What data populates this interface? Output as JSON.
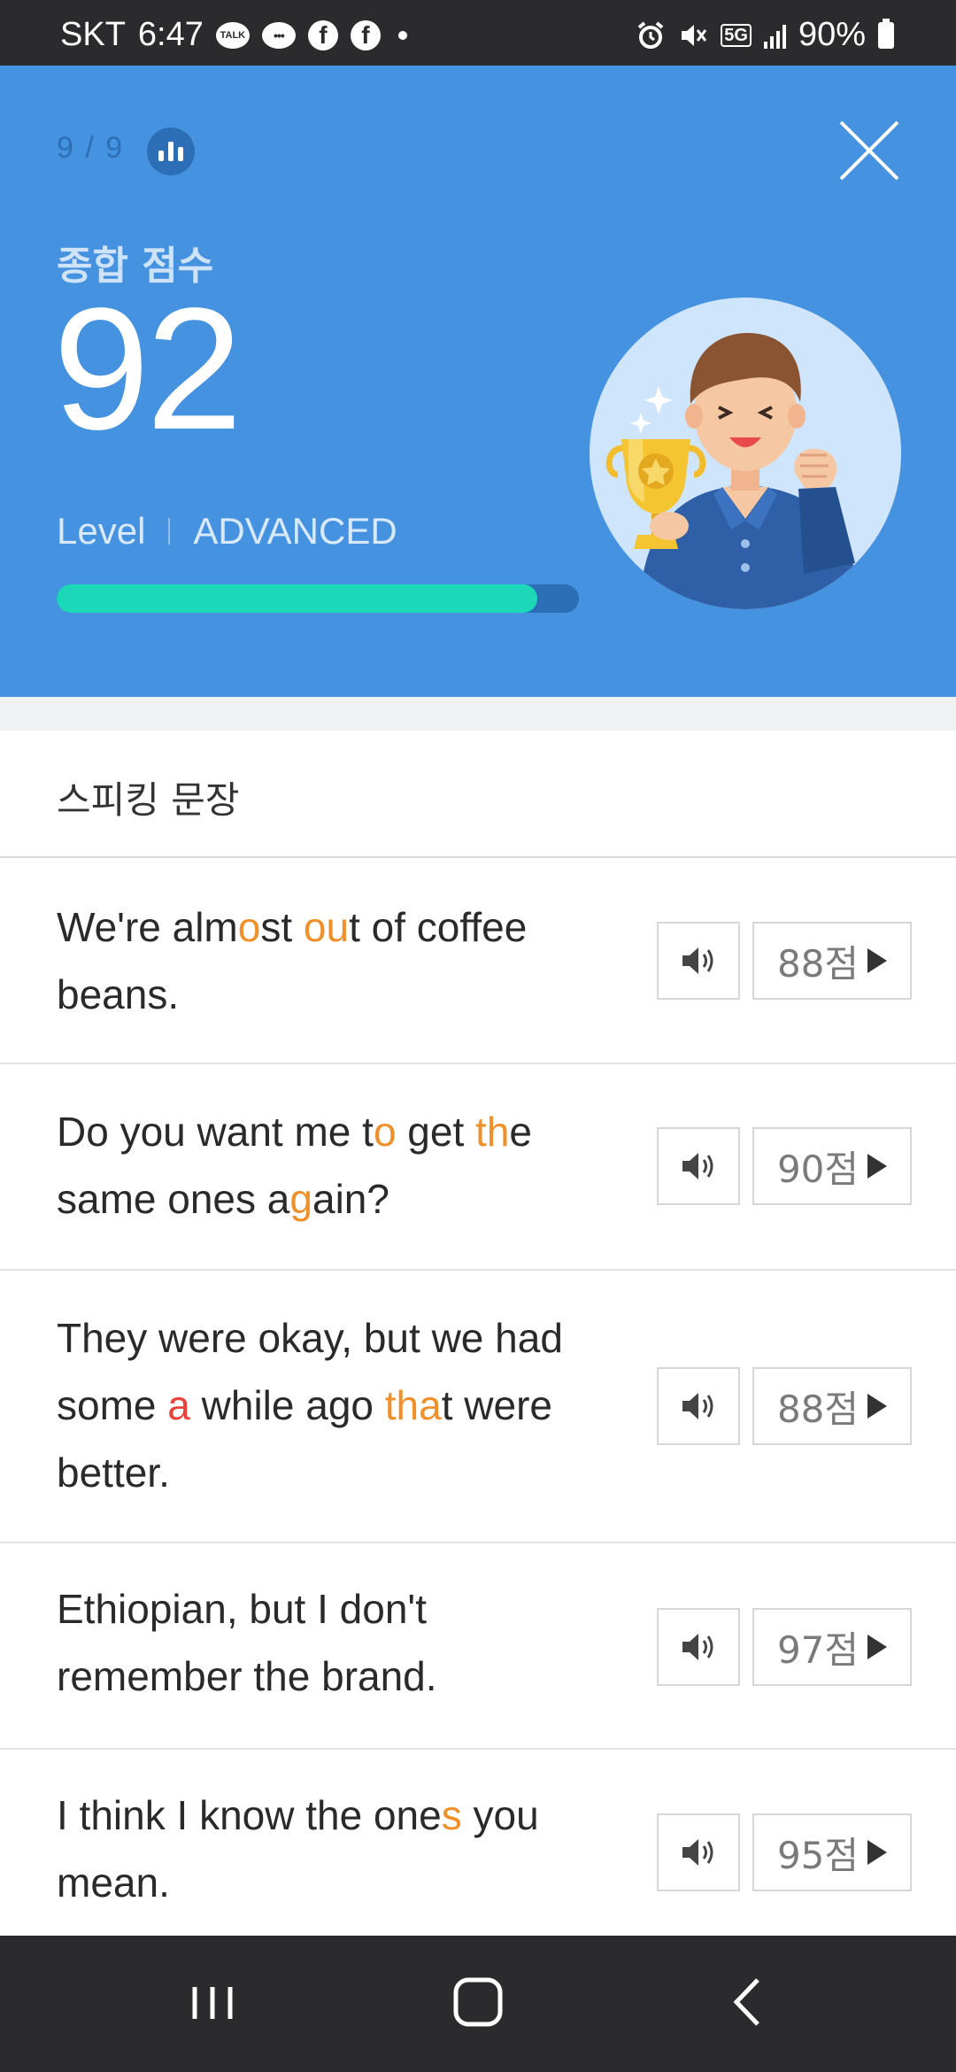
{
  "status_bar": {
    "carrier": "SKT",
    "time": "6:47",
    "talk_badge": "TALK",
    "network": "5G",
    "battery": "90%"
  },
  "header": {
    "progress": "9 / 9",
    "overall_label": "종합 점수",
    "score": "92",
    "level_label": "Level",
    "level_value": "ADVANCED",
    "progress_fraction": 0.92,
    "colors": {
      "background": "#4592e0",
      "bar_fill": "#1cd8b9",
      "bar_track": "#2c6fb6"
    }
  },
  "section": {
    "title": "스피킹 문장"
  },
  "sentences": [
    {
      "score_label": "88점",
      "segments": [
        {
          "t": "We're alm",
          "c": ""
        },
        {
          "t": "o",
          "c": "o"
        },
        {
          "t": "st ",
          "c": ""
        },
        {
          "t": "ou",
          "c": "o"
        },
        {
          "t": "t of coffee beans.",
          "c": ""
        }
      ]
    },
    {
      "score_label": "90점",
      "segments": [
        {
          "t": "Do you want me t",
          "c": ""
        },
        {
          "t": "o",
          "c": "o"
        },
        {
          "t": " get ",
          "c": ""
        },
        {
          "t": "th",
          "c": "o"
        },
        {
          "t": "e same ones a",
          "c": ""
        },
        {
          "t": "g",
          "c": "o"
        },
        {
          "t": "ain?",
          "c": ""
        }
      ]
    },
    {
      "score_label": "88점",
      "segments": [
        {
          "t": "They were okay, but we had some ",
          "c": ""
        },
        {
          "t": "a",
          "c": "r"
        },
        {
          "t": " while ago ",
          "c": ""
        },
        {
          "t": "tha",
          "c": "o"
        },
        {
          "t": "t were better.",
          "c": ""
        }
      ]
    },
    {
      "score_label": "97점",
      "segments": [
        {
          "t": "Ethiopian, but I don't remember the brand.",
          "c": ""
        }
      ]
    },
    {
      "score_label": "95점",
      "segments": [
        {
          "t": "I think I know the one",
          "c": ""
        },
        {
          "t": "s",
          "c": "o"
        },
        {
          "t": " you mean.",
          "c": ""
        }
      ]
    }
  ],
  "highlight_colors": {
    "o": "#f0902a",
    "r": "#e8423c"
  }
}
